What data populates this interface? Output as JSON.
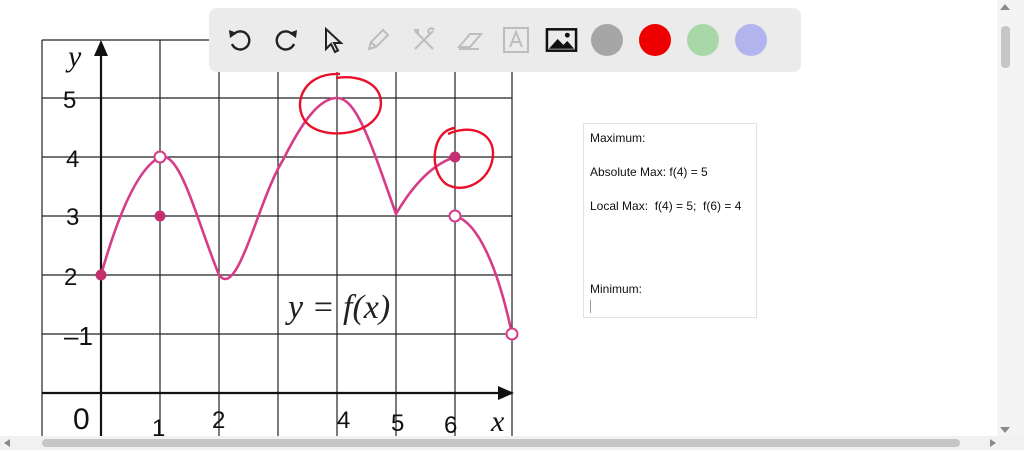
{
  "toolbar": {
    "tools": [
      {
        "icon": "undo-icon"
      },
      {
        "icon": "redo-icon"
      },
      {
        "icon": "pointer-icon"
      },
      {
        "icon": "pencil-icon"
      },
      {
        "icon": "tools-icon"
      },
      {
        "icon": "eraser-icon"
      },
      {
        "icon": "text-icon"
      },
      {
        "icon": "image-icon"
      }
    ],
    "colors": [
      "#a6a6a6",
      "#ee0000",
      "#a8d8a8",
      "#b3b3ee"
    ]
  },
  "graph": {
    "axis_x_label": "x",
    "axis_y_label": "y",
    "origin_label": "0",
    "x_ticks": [
      "1",
      "2",
      "4",
      "5",
      "6"
    ],
    "y_ticks": [
      "2",
      "3",
      "4",
      "5"
    ],
    "y_tick_1": "1",
    "equation": "y = f(x)",
    "curve_color": "#d63c8a",
    "annotation_color": "#e8102a",
    "solid_points": [
      [
        0,
        2
      ],
      [
        1,
        3
      ],
      [
        6,
        4
      ]
    ],
    "open_points": [
      [
        1,
        4
      ],
      [
        6,
        3
      ],
      [
        7,
        1
      ]
    ]
  },
  "notes": {
    "maximum_label": "Maximum:",
    "absolute_max": "Absolute Max: f(4) = 5",
    "local_max": "Local Max:  f(4) = 5;  f(6) = 4",
    "minimum_label": "Minimum:"
  }
}
